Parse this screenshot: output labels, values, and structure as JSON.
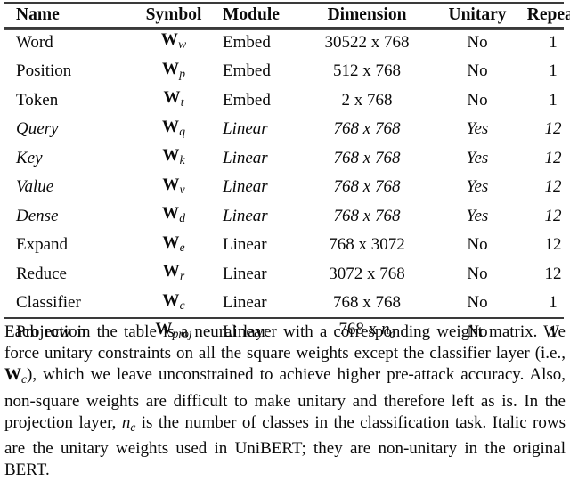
{
  "table": {
    "columns": [
      "Name",
      "Symbol",
      "Module",
      "Dimension",
      "Unitary",
      "Repeat"
    ],
    "rows": [
      {
        "name": "Word",
        "symbol_base": "W",
        "symbol_sub": "w",
        "module": "Embed",
        "dimension": "30522 x 768",
        "unitary": "No",
        "repeat": "1",
        "italic": false
      },
      {
        "name": "Position",
        "symbol_base": "W",
        "symbol_sub": "p",
        "module": "Embed",
        "dimension": "512 x 768",
        "unitary": "No",
        "repeat": "1",
        "italic": false
      },
      {
        "name": "Token",
        "symbol_base": "W",
        "symbol_sub": "t",
        "module": "Embed",
        "dimension": "2 x 768",
        "unitary": "No",
        "repeat": "1",
        "italic": false
      },
      {
        "name": "Query",
        "symbol_base": "W",
        "symbol_sub": "q",
        "module": "Linear",
        "dimension": "768 x 768",
        "unitary": "Yes",
        "repeat": "12",
        "italic": true
      },
      {
        "name": "Key",
        "symbol_base": "W",
        "symbol_sub": "k",
        "module": "Linear",
        "dimension": "768 x 768",
        "unitary": "Yes",
        "repeat": "12",
        "italic": true
      },
      {
        "name": "Value",
        "symbol_base": "W",
        "symbol_sub": "v",
        "module": "Linear",
        "dimension": "768 x 768",
        "unitary": "Yes",
        "repeat": "12",
        "italic": true
      },
      {
        "name": "Dense",
        "symbol_base": "W",
        "symbol_sub": "d",
        "module": "Linear",
        "dimension": "768 x 768",
        "unitary": "Yes",
        "repeat": "12",
        "italic": true
      },
      {
        "name": "Expand",
        "symbol_base": "W",
        "symbol_sub": "e",
        "module": "Linear",
        "dimension": "768 x 3072",
        "unitary": "No",
        "repeat": "12",
        "italic": false
      },
      {
        "name": "Reduce",
        "symbol_base": "W",
        "symbol_sub": "r",
        "module": "Linear",
        "dimension": "3072 x 768",
        "unitary": "No",
        "repeat": "12",
        "italic": false
      },
      {
        "name": "Classifier",
        "symbol_base": "W",
        "symbol_sub": "c",
        "module": "Linear",
        "dimension": "768 x 768",
        "unitary": "No",
        "repeat": "1",
        "italic": false
      },
      {
        "name": "Projection",
        "symbol_base": "W",
        "symbol_sub": "proj",
        "module": "Linear",
        "dimension_prefix": "768 x ",
        "dimension_math_base": "n",
        "dimension_math_sub": "c",
        "dimension": "768 x n_c",
        "unitary": "No",
        "repeat": "1",
        "italic": false
      }
    ]
  },
  "caption": {
    "part1": "Each row in the table is a neural layer with a corresponding weight matrix. We force unitary constraints on all the square weights except the classifier layer (i.e., ",
    "math1_base": "W",
    "math1_sub": "c",
    "part2": "), which we leave unconstrained to achieve higher pre-attack accuracy. Also, non-square weights are difficult to make unitary and therefore left as is. In the projection layer, ",
    "math2_base": "n",
    "math2_sub": "c",
    "part3": " is the number of classes in the classification task. Italic rows are the unitary weights used in UniBERT; they are non-unitary in the original BERT."
  },
  "colors": {
    "text": "#0a0a0a",
    "rule": "#3a3a3a",
    "background": "#ffffff"
  }
}
